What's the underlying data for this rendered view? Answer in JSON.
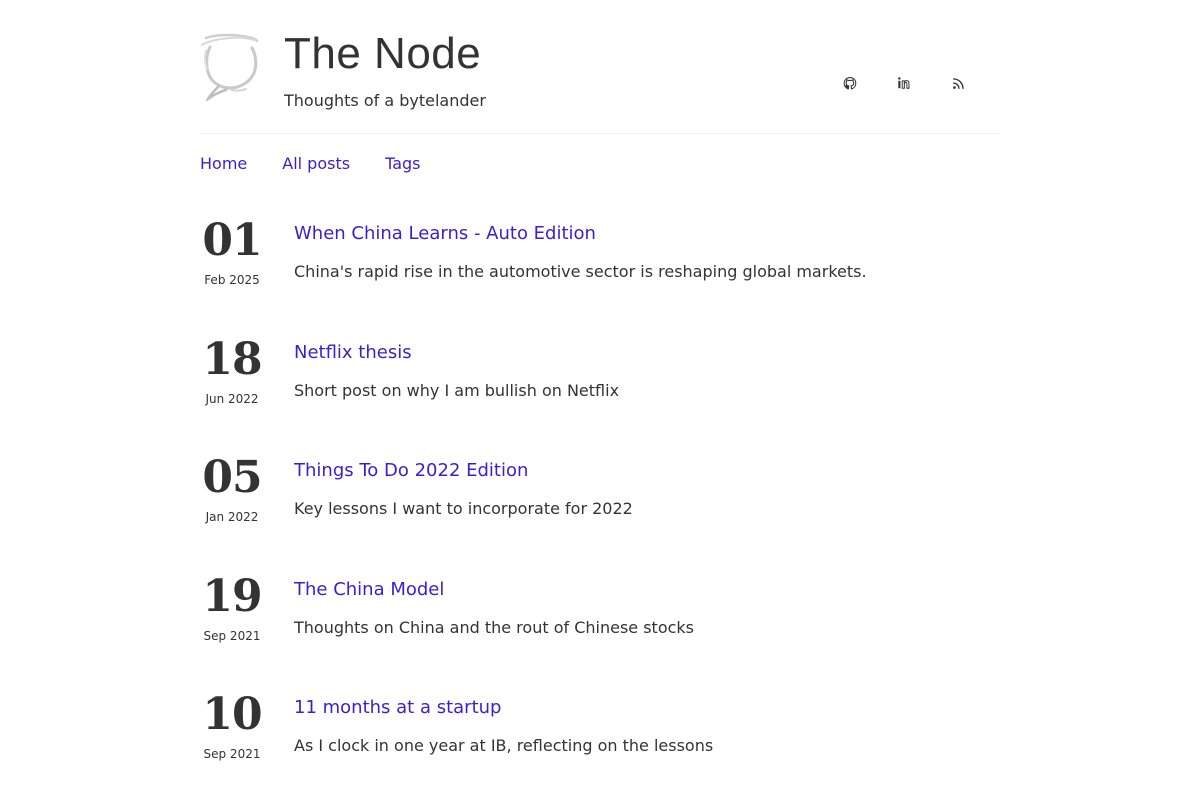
{
  "site": {
    "title": "The Node",
    "subtitle": "Thoughts of a bytelander"
  },
  "social": [
    {
      "icon": "github-icon"
    },
    {
      "icon": "linkedin-icon"
    },
    {
      "icon": "rss-icon"
    }
  ],
  "nav": {
    "items": [
      {
        "label": "Home"
      },
      {
        "label": "All posts"
      },
      {
        "label": "Tags"
      }
    ]
  },
  "colors": {
    "link": "#3b1fcf",
    "text": "#333333",
    "divider": "#eeeeee"
  },
  "posts": [
    {
      "day": "01",
      "month": "Feb 2025",
      "title": "When China Learns - Auto Edition",
      "description": "China's rapid rise in the automotive sector is reshaping global markets."
    },
    {
      "day": "18",
      "month": "Jun 2022",
      "title": "Netflix thesis",
      "description": "Short post on why I am bullish on Netflix"
    },
    {
      "day": "05",
      "month": "Jan 2022",
      "title": "Things To Do 2022 Edition",
      "description": "Key lessons I want to incorporate for 2022"
    },
    {
      "day": "19",
      "month": "Sep 2021",
      "title": "The China Model",
      "description": "Thoughts on China and the rout of Chinese stocks"
    },
    {
      "day": "10",
      "month": "Sep 2021",
      "title": "11 months at a startup",
      "description": "As I clock in one year at IB, reflecting on the lessons"
    }
  ]
}
